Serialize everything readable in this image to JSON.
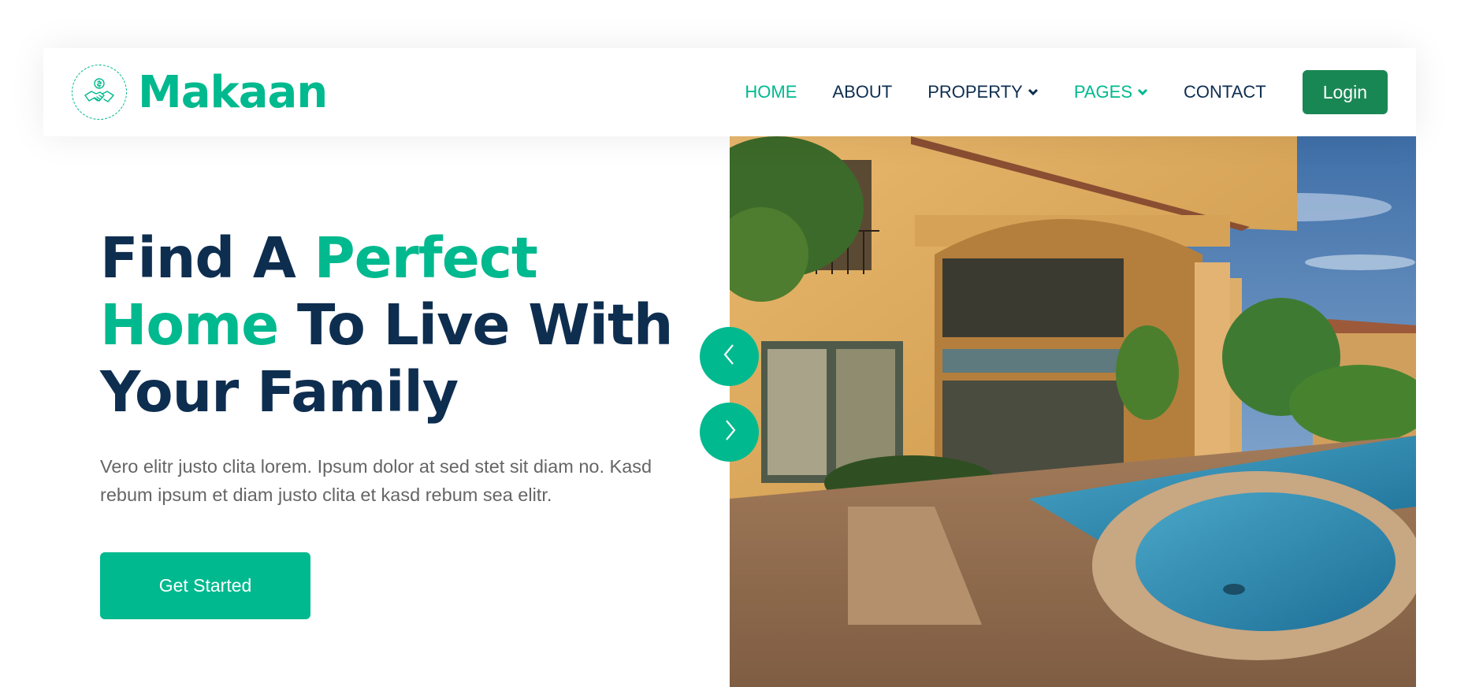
{
  "brand": {
    "name": "Makaan",
    "logo_icon": "handshake-house-icon"
  },
  "nav": {
    "items": [
      {
        "label": "HOME",
        "active": true,
        "dropdown": false
      },
      {
        "label": "ABOUT",
        "active": false,
        "dropdown": false
      },
      {
        "label": "PROPERTY",
        "active": false,
        "dropdown": true
      },
      {
        "label": "PAGES",
        "active": true,
        "dropdown": true
      },
      {
        "label": "CONTACT",
        "active": false,
        "dropdown": false
      }
    ],
    "login_label": "Login"
  },
  "hero": {
    "title_part1": "Find A ",
    "title_accent1": "Perfect",
    "title_accent2": "Home",
    "title_part2": " To Live With",
    "title_part3": "Your Family",
    "description": "Vero elitr justo clita lorem. Ipsum dolor at sed stet sit diam no. Kasd rebum ipsum et diam justo clita et kasd rebum sea elitr.",
    "cta_label": "Get Started"
  },
  "carousel": {
    "prev_icon": "chevron-left-icon",
    "next_icon": "chevron-right-icon"
  },
  "colors": {
    "primary": "#00b98e",
    "dark": "#0e2e50",
    "login": "#198754",
    "text": "#666565"
  }
}
